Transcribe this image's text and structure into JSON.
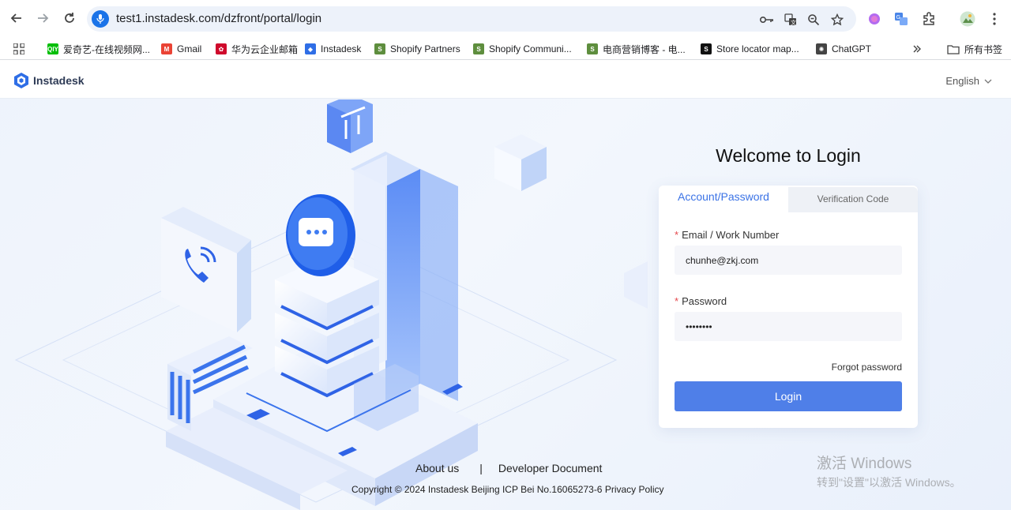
{
  "browser": {
    "url": "test1.instadesk.com/dzfront/portal/login",
    "bookmarks": [
      {
        "label": "爱奇艺-在线视频网...",
        "color": "#00be06",
        "icon": "iqiyi-icon",
        "abbr": "iQIYI"
      },
      {
        "label": "Gmail",
        "color": "#ea4335",
        "icon": "gmail-icon",
        "abbr": "M"
      },
      {
        "label": "华为云企业邮箱",
        "color": "#cf0a2c",
        "icon": "huawei-icon",
        "abbr": "✿"
      },
      {
        "label": "Instadesk",
        "color": "#2f6ee6",
        "icon": "instadesk-icon",
        "abbr": "◆"
      },
      {
        "label": "Shopify Partners",
        "color": "#5e8e3e",
        "icon": "shopify-icon",
        "abbr": "S"
      },
      {
        "label": "Shopify Communi...",
        "color": "#5e8e3e",
        "icon": "shopify-icon",
        "abbr": "S"
      },
      {
        "label": "电商营销博客 - 电...",
        "color": "#5e8e3e",
        "icon": "shopify-icon",
        "abbr": "S"
      },
      {
        "label": "Store locator map...",
        "color": "#111111",
        "icon": "store-locator-icon",
        "abbr": "S"
      },
      {
        "label": "ChatGPT",
        "color": "#444444",
        "icon": "chatgpt-icon",
        "abbr": "✺"
      }
    ],
    "all_bookmarks_label": "所有书签"
  },
  "header": {
    "logo_text": "Instadesk",
    "language": "English"
  },
  "login": {
    "title": "Welcome to Login",
    "tab_account": "Account/Password",
    "tab_code": "Verification Code",
    "email_label": "Email / Work Number",
    "email_value": "chunhe@zkj.com",
    "password_label": "Password",
    "password_value": "••••••••",
    "required_mark": "*",
    "forgot": "Forgot password",
    "login_button": "Login"
  },
  "footer": {
    "about": "About us",
    "separator": "|",
    "developer": "Developer Document",
    "copyright": "Copyright © 2024  Instadesk Beijing ICP Bei No.16065273-6 Privacy Policy"
  },
  "watermark": {
    "line1": "激活 Windows",
    "line2": "转到\"设置\"以激活 Windows。"
  },
  "colors": {
    "accent": "#4f7fe8",
    "tab_active": "#3b73e6",
    "required": "#e5484d"
  }
}
